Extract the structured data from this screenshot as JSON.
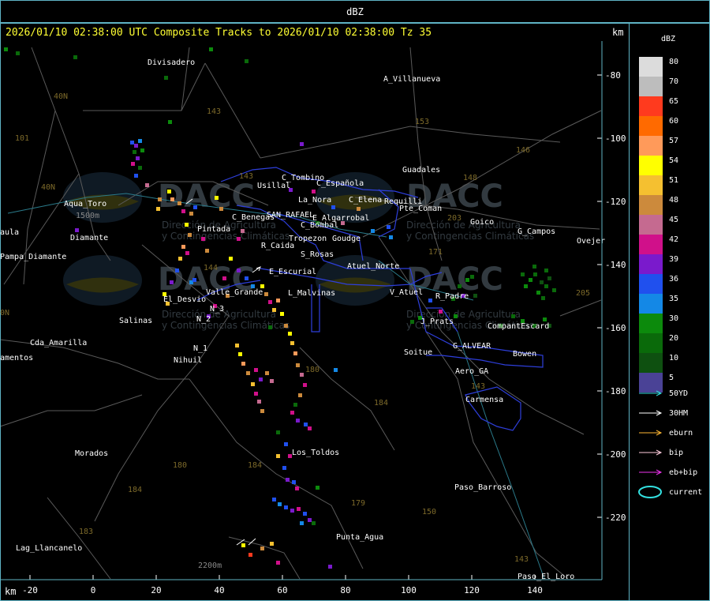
{
  "header": {
    "title": "dBZ"
  },
  "map_title": "2026/01/10 02:38:00 UTC Composite Tracks to 2026/01/10 02:38:00 Tz 35",
  "axis_unit_top": "km",
  "axis_unit_bottom": "km",
  "x_ticks": [
    "-20",
    "0",
    "20",
    "40",
    "60",
    "80",
    "100",
    "120",
    "140"
  ],
  "y_ticks": [
    "-80",
    "-100",
    "-120",
    "-140",
    "-160",
    "-180",
    "-200",
    "-220"
  ],
  "watermark": {
    "brand": "DACC",
    "line1": "Dirección de Agricultura",
    "line2": "y Contingencias Climáticas"
  },
  "places": [
    {
      "name": "Divisadero",
      "color": "#ffffff"
    },
    {
      "name": "A_Villanueva",
      "color": "#ffffff"
    },
    {
      "name": "Guadales",
      "color": "#ffffff"
    },
    {
      "name": "C_Tombino",
      "color": "#ffffff"
    },
    {
      "name": "C_Española",
      "color": "#ffffff"
    },
    {
      "name": "Usillal",
      "color": "#ffffff"
    },
    {
      "name": "La_Nora",
      "color": "#ffffff"
    },
    {
      "name": "C_Elena",
      "color": "#ffffff"
    },
    {
      "name": "Requilli",
      "color": "#ffffff"
    },
    {
      "name": "Pte_Coman",
      "color": "#ffffff"
    },
    {
      "name": "C_Benegas",
      "color": "#ffffff"
    },
    {
      "name": "SAN_RAFAEL",
      "color": "#ffffff"
    },
    {
      "name": "E_Algarrobal",
      "color": "#ffffff"
    },
    {
      "name": "Goico",
      "color": "#ffffff"
    },
    {
      "name": "G_Campos",
      "color": "#ffffff"
    },
    {
      "name": "Ovejer",
      "color": "#ffffff"
    },
    {
      "name": "C_Bombal",
      "color": "#ffffff"
    },
    {
      "name": "Pintada",
      "color": "#ffffff"
    },
    {
      "name": "Tropezon",
      "color": "#ffffff"
    },
    {
      "name": "Goudge",
      "color": "#ffffff"
    },
    {
      "name": "R_Caida",
      "color": "#ffffff"
    },
    {
      "name": "S_Rosas",
      "color": "#ffffff"
    },
    {
      "name": "Atuel_Norte",
      "color": "#ffffff"
    },
    {
      "name": "E_Escurial",
      "color": "#ffffff"
    },
    {
      "name": "Aqua_Toro",
      "color": "#ffffff"
    },
    {
      "name": "1500m",
      "color": "#888888"
    },
    {
      "name": "Diamante",
      "color": "#ffffff"
    },
    {
      "name": "Pampa_Diamante",
      "color": "#ffffff"
    },
    {
      "name": "aula",
      "color": "#ffffff"
    },
    {
      "name": "Valle_Grande",
      "color": "#ffffff"
    },
    {
      "name": "L_Malvinas",
      "color": "#ffffff"
    },
    {
      "name": "V_Atuel",
      "color": "#ffffff"
    },
    {
      "name": "R_Padre",
      "color": "#ffffff"
    },
    {
      "name": "El_Desvio",
      "color": "#ffffff"
    },
    {
      "name": "Salinas",
      "color": "#ffffff"
    },
    {
      "name": "N_2",
      "color": "#ffffff"
    },
    {
      "name": "N_3",
      "color": "#ffffff"
    },
    {
      "name": "J_Prats",
      "color": "#ffffff"
    },
    {
      "name": "CompantEscard",
      "color": "#ffffff"
    },
    {
      "name": "Cda_Amarilla",
      "color": "#ffffff"
    },
    {
      "name": "N_1",
      "color": "#ffffff"
    },
    {
      "name": "G_ALVEAR",
      "color": "#ffffff"
    },
    {
      "name": "Bowen",
      "color": "#ffffff"
    },
    {
      "name": "amentos",
      "color": "#ffffff"
    },
    {
      "name": "Nihuil",
      "color": "#ffffff"
    },
    {
      "name": "Soitue",
      "color": "#ffffff"
    },
    {
      "name": "Aero_GA",
      "color": "#ffffff"
    },
    {
      "name": "Carmensa",
      "color": "#ffffff"
    },
    {
      "name": "Morados",
      "color": "#ffffff"
    },
    {
      "name": "Los_Toldos",
      "color": "#ffffff"
    },
    {
      "name": "Paso_Barroso",
      "color": "#ffffff"
    },
    {
      "name": "Punta_Agua",
      "color": "#ffffff"
    },
    {
      "name": "Lag_Llancanelo",
      "color": "#ffffff"
    },
    {
      "name": "2200m",
      "color": "#888888"
    },
    {
      "name": "Paso_El_Loro",
      "color": "#ffffff"
    }
  ],
  "route_labels": [
    "40N",
    "101",
    "143",
    "143",
    "153",
    "146",
    "148",
    "203",
    "171",
    "40N",
    "144",
    "184",
    "180",
    "184",
    "183",
    "143",
    "179",
    "150",
    "143",
    "184",
    "180",
    "205",
    "0N"
  ],
  "legend": {
    "title": "dBZ",
    "scale": [
      {
        "label": "80",
        "color": "#dcdcdc"
      },
      {
        "label": "70",
        "color": "#bdbdbd"
      },
      {
        "label": "65",
        "color": "#ff3a1e"
      },
      {
        "label": "60",
        "color": "#ff6a00"
      },
      {
        "label": "57",
        "color": "#ff9a5a"
      },
      {
        "label": "54",
        "color": "#ffff00"
      },
      {
        "label": "51",
        "color": "#f5c030"
      },
      {
        "label": "48",
        "color": "#cc8a3c"
      },
      {
        "label": "45",
        "color": "#c56a90"
      },
      {
        "label": "42",
        "color": "#d0108a"
      },
      {
        "label": "39",
        "color": "#7a1acc"
      },
      {
        "label": "36",
        "color": "#2050ee"
      },
      {
        "label": "35",
        "color": "#1488e6"
      },
      {
        "label": "30",
        "color": "#0c8a0c"
      },
      {
        "label": "20",
        "color": "#0a6a0a"
      },
      {
        "label": "10",
        "color": "#0e5010"
      },
      {
        "label": "5",
        "color": "#4a4296"
      }
    ],
    "tracks": [
      {
        "label": "50YD",
        "color": "#33dddd"
      },
      {
        "label": "30HM",
        "color": "#ffffff"
      },
      {
        "label": "eburn",
        "color": "#ffb833"
      },
      {
        "label": "bip",
        "color": "#ffccdd"
      },
      {
        "label": "eb+bip",
        "color": "#ee33ee"
      },
      {
        "label": "current",
        "color": "#33e0e0"
      }
    ]
  }
}
